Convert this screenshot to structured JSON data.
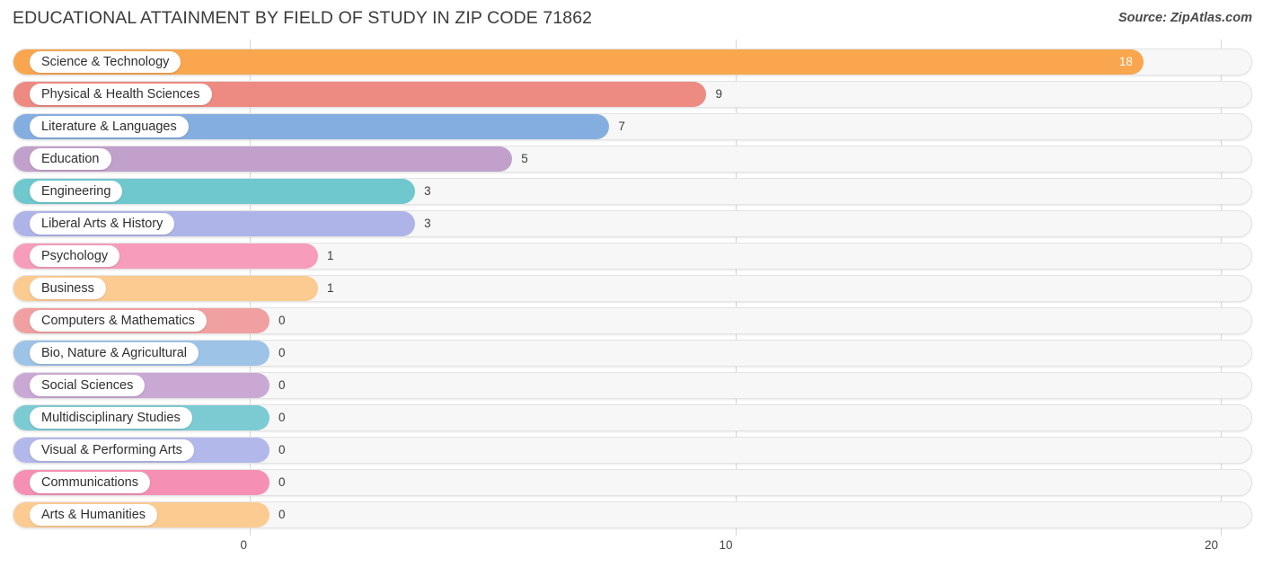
{
  "header": {
    "title": "EDUCATIONAL ATTAINMENT BY FIELD OF STUDY IN ZIP CODE 71862",
    "source": "Source: ZipAtlas.com"
  },
  "chart_data": {
    "type": "bar",
    "orientation": "horizontal",
    "title": "EDUCATIONAL ATTAINMENT BY FIELD OF STUDY IN ZIP CODE 71862",
    "xlabel": "",
    "ylabel": "",
    "xlim": [
      0,
      20
    ],
    "xticks": [
      "0",
      "10",
      "20"
    ],
    "xtick_values": [
      0,
      10,
      20
    ],
    "grid": true,
    "legend": "none",
    "categories": [
      "Science & Technology",
      "Physical & Health Sciences",
      "Literature & Languages",
      "Education",
      "Engineering",
      "Liberal Arts & History",
      "Psychology",
      "Business",
      "Computers & Mathematics",
      "Bio, Nature & Agricultural",
      "Social Sciences",
      "Multidisciplinary Studies",
      "Visual & Performing Arts",
      "Communications",
      "Arts & Humanities"
    ],
    "values": [
      18,
      9,
      7,
      5,
      3,
      3,
      1,
      1,
      0,
      0,
      0,
      0,
      0,
      0,
      0
    ],
    "value_labels": [
      "18",
      "9",
      "7",
      "5",
      "3",
      "3",
      "1",
      "1",
      "0",
      "0",
      "0",
      "0",
      "0",
      "0",
      "0"
    ],
    "colors": [
      "#f9a council",
      "#ed8a82",
      "#85aee0",
      "#c2a0cc",
      "#6ec8ce",
      "#aeb4e8",
      "#f79cbb",
      "#fccb91",
      "#f0a0a0",
      "#9dc3e6",
      "#c9a8d4",
      "#7ccbd2",
      "#b3b8ea",
      "#f68fb4",
      "#fccb91"
    ]
  },
  "bars": [
    {
      "label": "Science & Technology",
      "value": 18,
      "value_label": "18",
      "color": "#f9a64f",
      "value_inside": true
    },
    {
      "label": "Physical & Health Sciences",
      "value": 9,
      "value_label": "9",
      "color": "#ed8a82",
      "value_inside": false
    },
    {
      "label": "Literature & Languages",
      "value": 7,
      "value_label": "7",
      "color": "#85aee0",
      "value_inside": false
    },
    {
      "label": "Education",
      "value": 5,
      "value_label": "5",
      "color": "#c2a0cc",
      "value_inside": false
    },
    {
      "label": "Engineering",
      "value": 3,
      "value_label": "3",
      "color": "#6ec8ce",
      "value_inside": false
    },
    {
      "label": "Liberal Arts & History",
      "value": 3,
      "value_label": "3",
      "color": "#aeb4e8",
      "value_inside": false
    },
    {
      "label": "Psychology",
      "value": 1,
      "value_label": "1",
      "color": "#f79cbb",
      "value_inside": false
    },
    {
      "label": "Business",
      "value": 1,
      "value_label": "1",
      "color": "#fccb91",
      "value_inside": false
    },
    {
      "label": "Computers & Mathematics",
      "value": 0,
      "value_label": "0",
      "color": "#f0a0a0",
      "value_inside": false
    },
    {
      "label": "Bio, Nature & Agricultural",
      "value": 0,
      "value_label": "0",
      "color": "#9dc3e6",
      "value_inside": false
    },
    {
      "label": "Social Sciences",
      "value": 0,
      "value_label": "0",
      "color": "#c9a8d4",
      "value_inside": false
    },
    {
      "label": "Multidisciplinary Studies",
      "value": 0,
      "value_label": "0",
      "color": "#7ccbd2",
      "value_inside": false
    },
    {
      "label": "Visual & Performing Arts",
      "value": 0,
      "value_label": "0",
      "color": "#b3b8ea",
      "value_inside": false
    },
    {
      "label": "Communications",
      "value": 0,
      "value_label": "0",
      "color": "#f68fb4",
      "value_inside": false
    },
    {
      "label": "Arts & Humanities",
      "value": 0,
      "value_label": "0",
      "color": "#fccb91",
      "value_inside": false
    }
  ],
  "axis": {
    "ticks": [
      {
        "label": "0",
        "value": 0
      },
      {
        "label": "10",
        "value": 10
      },
      {
        "label": "20",
        "value": 20
      }
    ]
  }
}
